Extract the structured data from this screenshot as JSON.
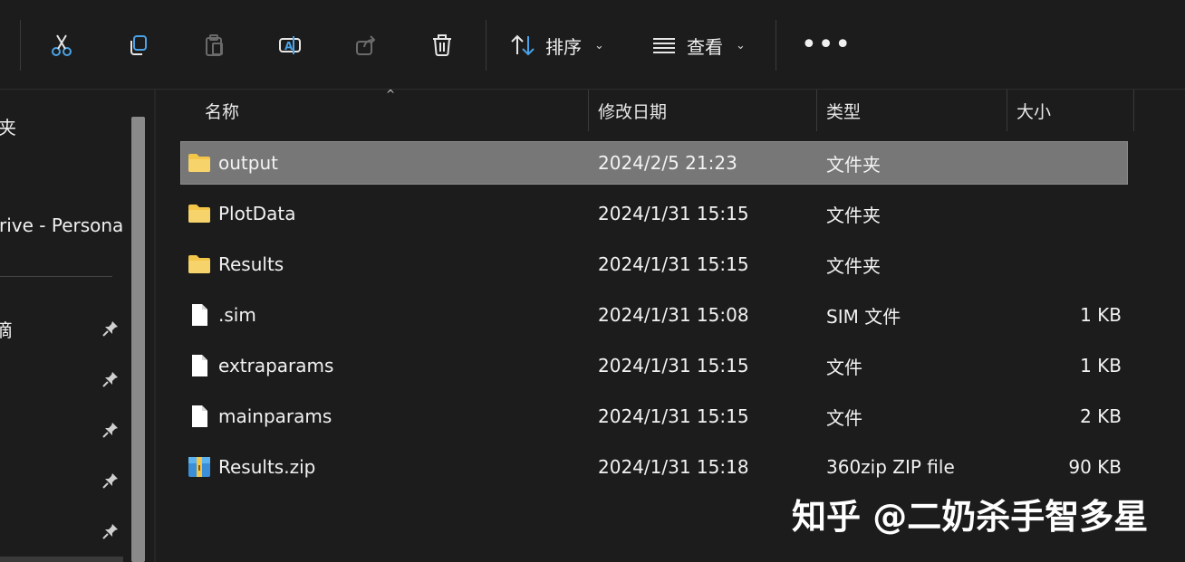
{
  "toolbar": {
    "sort_label": "排序",
    "view_label": "查看",
    "more_label": "•••"
  },
  "sidebar": {
    "items": [
      {
        "label": "夹"
      },
      {
        "label": "rive - Persona"
      },
      {
        "label": "滴"
      }
    ]
  },
  "columns": {
    "name": "名称",
    "date": "修改日期",
    "type": "类型",
    "size": "大小"
  },
  "files": [
    {
      "name": "output",
      "date": "2024/2/5 21:23",
      "type": "文件夹",
      "size": "",
      "icon": "folder-icon",
      "selected": true
    },
    {
      "name": "PlotData",
      "date": "2024/1/31 15:15",
      "type": "文件夹",
      "size": "",
      "icon": "folder-icon"
    },
    {
      "name": "Results",
      "date": "2024/1/31 15:15",
      "type": "文件夹",
      "size": "",
      "icon": "folder-icon"
    },
    {
      "name": ".sim",
      "date": "2024/1/31 15:08",
      "type": "SIM 文件",
      "size": "1 KB",
      "icon": "file-icon"
    },
    {
      "name": "extraparams",
      "date": "2024/1/31 15:15",
      "type": "文件",
      "size": "1 KB",
      "icon": "file-icon"
    },
    {
      "name": "mainparams",
      "date": "2024/1/31 15:15",
      "type": "文件",
      "size": "2 KB",
      "icon": "file-icon"
    },
    {
      "name": "Results.zip",
      "date": "2024/1/31 15:18",
      "type": "360zip ZIP file",
      "size": "90 KB",
      "icon": "zip-icon"
    }
  ],
  "watermark": "知乎 @二奶杀手智多星",
  "colors": {
    "accent": "#4aa3e8",
    "folder": "#f3c64a",
    "selected_row": "#777777"
  }
}
